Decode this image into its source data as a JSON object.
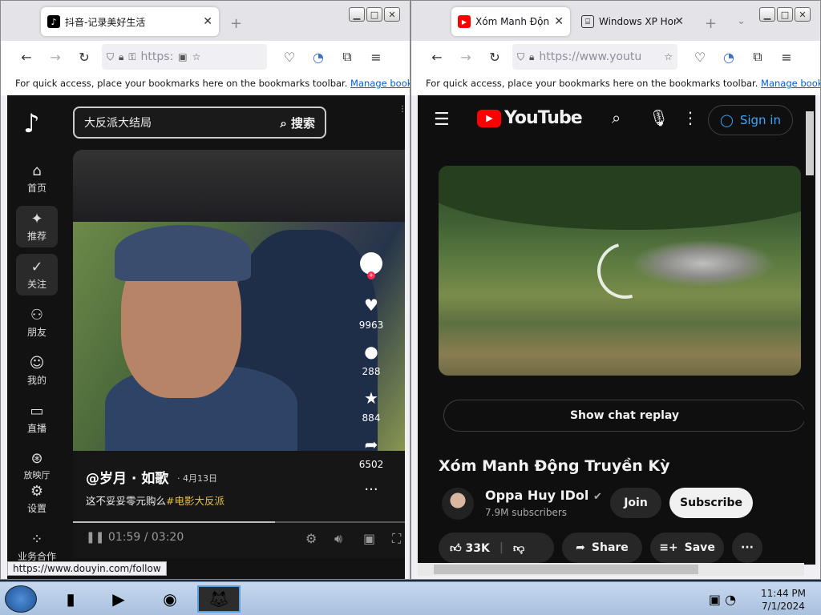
{
  "left_browser": {
    "tab_title": "抖音-记录美好生活",
    "url": "https:",
    "bookmarks_text": "For quick access, place your bookmarks here on the bookmarks toolbar.",
    "bookmarks_link": "Manage bookmarks",
    "status_url": "https://www.douyin.com/follow"
  },
  "douyin": {
    "search_placeholder": "大反派大结局",
    "search_button": "搜索",
    "nav": [
      {
        "label": "首页",
        "icon": "home-icon"
      },
      {
        "label": "推荐",
        "icon": "sparkle-icon"
      },
      {
        "label": "关注",
        "icon": "follow-icon"
      },
      {
        "label": "朋友",
        "icon": "friends-icon"
      },
      {
        "label": "我的",
        "icon": "profile-icon"
      },
      {
        "label": "直播",
        "icon": "live-icon"
      },
      {
        "label": "放映厅",
        "icon": "cinema-icon"
      },
      {
        "label": "设置",
        "icon": "settings-icon"
      },
      {
        "label": "业务合作",
        "icon": "business-icon"
      }
    ],
    "author": "@岁月 · 如歌",
    "date": "· 4月13日",
    "description": "这不妥妥零元购么",
    "hashtag": "#电影大反派",
    "time": "01:59 / 03:20",
    "progress": 0.6,
    "likes": "9963",
    "comments": "288",
    "favorites": "884",
    "shares": "6502"
  },
  "right_browser": {
    "tabs": [
      {
        "title": "Xóm Manh Động",
        "active": true
      },
      {
        "title": "Windows XP Hom",
        "active": false
      }
    ],
    "url": "https://www.youtu",
    "bookmarks_text": "For quick access, place your bookmarks here on the bookmarks toolbar.",
    "bookmarks_link": "Manage bookmarks"
  },
  "youtube": {
    "logo_text": "YouTube",
    "sign_in": "Sign in",
    "chat_replay": "Show chat replay",
    "video_title": "Xóm Manh Động Truyền Kỳ",
    "channel_name": "Oppa Huy IDol",
    "subscribers": "7.9M subscribers",
    "join": "Join",
    "subscribe": "Subscribe",
    "likes": "33K",
    "share": "Share",
    "save": "Save",
    "more": "···"
  },
  "taskbar": {
    "time": "11:44 PM",
    "date": "7/1/2024"
  }
}
